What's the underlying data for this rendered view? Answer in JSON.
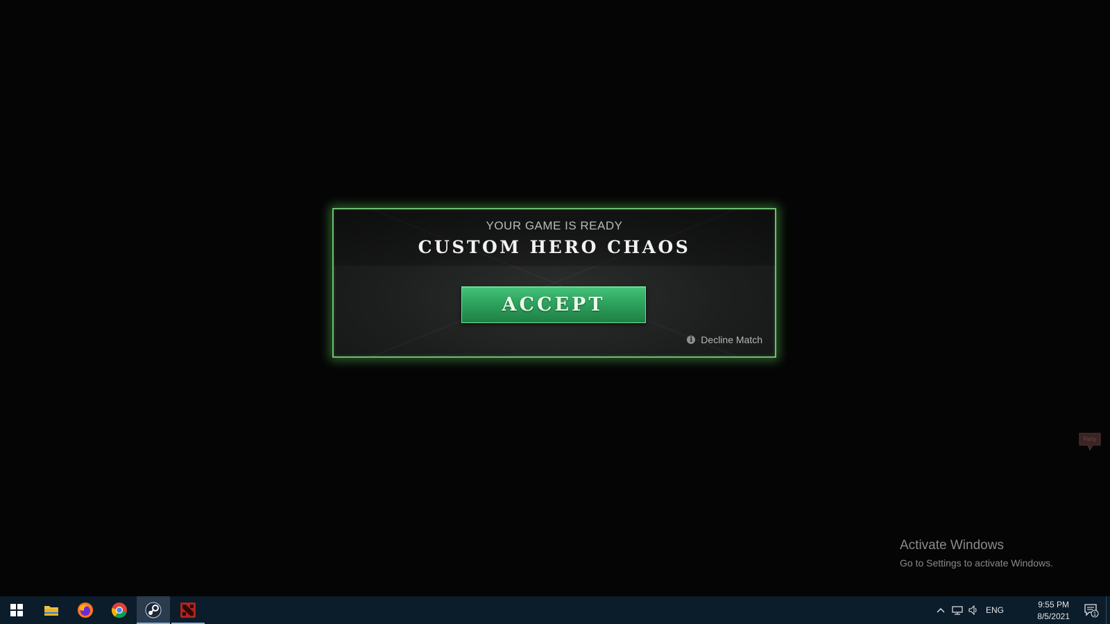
{
  "dialog": {
    "subtitle": "YOUR GAME IS READY",
    "title": "CUSTOM HERO CHAOS",
    "accept_label": "ACCEPT",
    "decline_label": "Decline Match"
  },
  "party": {
    "label": "Party"
  },
  "watermark": {
    "title": "Activate Windows",
    "subtitle": "Go to Settings to activate Windows."
  },
  "taskbar": {
    "apps": [
      {
        "name": "start",
        "icon": "windows-logo-icon"
      },
      {
        "name": "file-explorer",
        "icon": "folder-icon"
      },
      {
        "name": "firefox",
        "icon": "firefox-icon"
      },
      {
        "name": "chrome",
        "icon": "chrome-icon"
      },
      {
        "name": "steam",
        "icon": "steam-icon",
        "active": true
      },
      {
        "name": "dota2",
        "icon": "dota2-icon",
        "running": true
      }
    ],
    "tray": {
      "language": "ENG",
      "time": "9:55 PM",
      "date": "8/5/2021",
      "notification_count": "1"
    }
  },
  "colors": {
    "accent_green": "#2ea35e",
    "dialog_border": "#6fbf6f",
    "taskbar_bg": "#0b1c2b"
  }
}
